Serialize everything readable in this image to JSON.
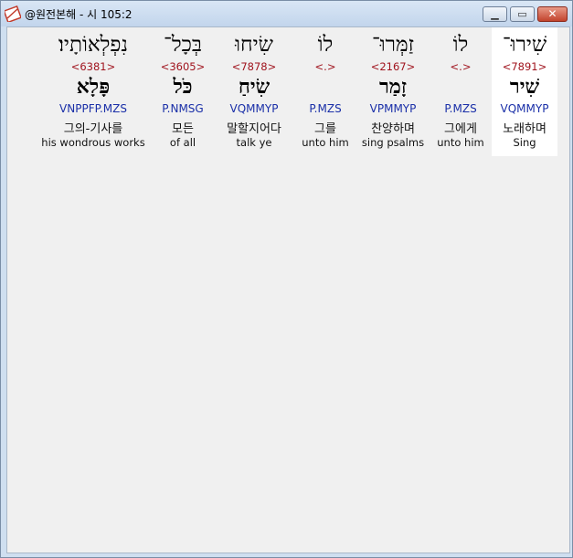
{
  "window": {
    "title": "@원전본해 - 시 105:2"
  },
  "words": [
    {
      "hebrew": "שִׁירוּ־",
      "strong": "<7891>",
      "root": "שִׁיר",
      "morph": "VQMMYP",
      "korean": "노래하며",
      "english": "Sing",
      "selected": true
    },
    {
      "hebrew": "לוֹ",
      "strong": "<.>",
      "root": "",
      "morph": "P.MZS",
      "korean": "그에게",
      "english": "unto him",
      "selected": false
    },
    {
      "hebrew": "זַמְּרוּ־",
      "strong": "<2167>",
      "root": "זָמַר",
      "morph": "VPMMYP",
      "korean": "찬양하며",
      "english": "sing psalms",
      "selected": false
    },
    {
      "hebrew": "לוֹ",
      "strong": "<.>",
      "root": "",
      "morph": "P.MZS",
      "korean": "그를",
      "english": "unto him",
      "selected": false
    },
    {
      "hebrew": "שִׂיחוּ",
      "strong": "<7878>",
      "root": "שִׂיחַ",
      "morph": "VQMMYP",
      "korean": "말할지어다",
      "english": "talk ye",
      "selected": false
    },
    {
      "hebrew": "בְּכָל־",
      "strong": "<3605>",
      "root": "כֹּל",
      "morph": "P.NMSG",
      "korean": "모든",
      "english": "of all",
      "selected": false
    },
    {
      "hebrew": "נִפְלְאוֹתָיו׃",
      "strong": "<6381>",
      "root": "פָּלָא",
      "morph": "VNPPFP.MZS",
      "korean": "그의-기사를",
      "english": "his wondrous works",
      "selected": false
    }
  ]
}
